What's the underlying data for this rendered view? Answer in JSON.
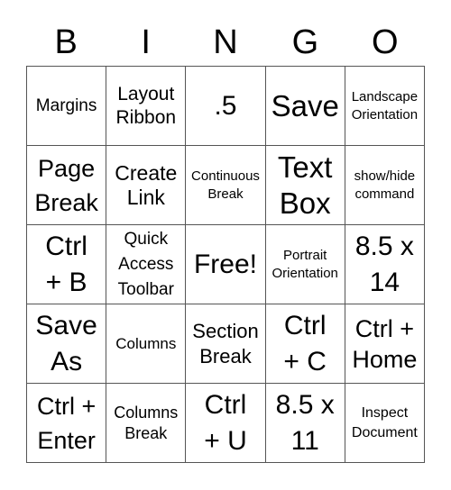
{
  "header": {
    "letters": [
      "B",
      "I",
      "N",
      "G",
      "O"
    ]
  },
  "cells": [
    [
      "Margins",
      "Layout\nRibbon",
      ".5",
      "Save",
      "Landscape\nOrientation"
    ],
    [
      "Page\nBreak",
      "Create\nLink",
      "Continuous\nBreak",
      "Text\nBox",
      "show/hide\ncommand"
    ],
    [
      "Ctrl\n+ B",
      "Quick\nAccess\nToolbar",
      "Free!",
      "Portrait\nOrientation",
      "8.5 x\n14"
    ],
    [
      "Save\nAs",
      "Columns",
      "Section\nBreak",
      "Ctrl\n+ C",
      "Ctrl +\nHome"
    ],
    [
      "Ctrl +\nEnter",
      "Columns\nBreak",
      "Ctrl\n+ U",
      "8.5 x\n11",
      "Inspect\nDocument"
    ]
  ]
}
